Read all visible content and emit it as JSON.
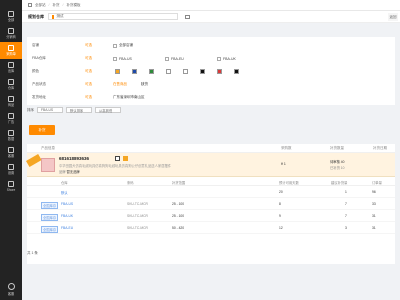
{
  "nav": {
    "items": [
      {
        "label": "全部"
      },
      {
        "label": "分销商"
      },
      {
        "label": "采购单",
        "active": true
      },
      {
        "label": "出库"
      },
      {
        "label": "仓库"
      },
      {
        "label": "商品"
      },
      {
        "label": "广告"
      },
      {
        "label": "数据"
      },
      {
        "label": "客服"
      },
      {
        "label": "设置"
      },
      {
        "label": "Shore"
      }
    ],
    "bottom_label": "客服"
  },
  "topbar": {
    "crumbs": [
      "全部站",
      "补货",
      "补货模板"
    ]
  },
  "subhead": {
    "title": "规划仓库",
    "selected": "测试",
    "return_label": "返回"
  },
  "filter": {
    "rows": [
      {
        "label": "店铺",
        "group": "可选",
        "options": [
          "全部店铺"
        ]
      },
      {
        "label": "FBA仓库",
        "group": "可选",
        "options": [
          "FBA-US",
          "FBA-EU",
          "FBA-UK"
        ]
      },
      {
        "label": "颜色",
        "group": "可选",
        "colors": [
          "#f5a623",
          "#1e4aa8",
          "#2e8b3a",
          "#ffffff",
          "#ffffff",
          "#111111",
          "#d93a3a",
          "#111111"
        ]
      },
      {
        "label": "产品状态",
        "group": "可选",
        "options": [
          "在售商品",
          "缺货"
        ]
      },
      {
        "label": "发货地址",
        "group": "可选",
        "address": "广东省深圳市南山区"
      }
    ],
    "sort_label": "排序",
    "dropdowns": [
      "FBA-US",
      "默认排序",
      "从高到低"
    ]
  },
  "result_button": "补货",
  "table": {
    "headers": [
      "产品信息",
      "采购数",
      "补货数量",
      "补货日期"
    ],
    "product": {
      "id": "681618893636",
      "title": "中华田园犬仿真毛绒玩具仿真狗狗毛绒玩具仿真狗公仔创意礼品送人家居摆件",
      "meta_label": "品牌",
      "meta_value": "暂无品牌",
      "qty": "¥ 1",
      "status": "待审核 40",
      "status2": "已补货 10"
    },
    "sub_headers": [
      "仓库",
      "条码",
      "补货范围",
      "预计可用天数",
      "建议补货量",
      "订单量"
    ],
    "sub_rows": [
      {
        "tag": "仓库",
        "name": "默认",
        "sku": "",
        "range": "",
        "qty1": "20",
        "qty2": "1",
        "qty3": "96"
      },
      {
        "tag": "全国库存",
        "name": "FBA-US",
        "sku": "SKU-TC-MCR",
        "range": "25 - 100",
        "qty1": "8",
        "qty2": "7",
        "qty3": "33"
      },
      {
        "tag": "全国库存",
        "name": "FBA-UK",
        "sku": "SKU-TC-MCR",
        "range": "25 - 100",
        "qty1": "9",
        "qty2": "7",
        "qty3": "31"
      },
      {
        "tag": "全国库存",
        "name": "FBA-EU",
        "sku": "SKU-TC-MCR",
        "range": "50 - 420",
        "qty1": "12",
        "qty2": "3",
        "qty3": "31"
      }
    ]
  },
  "footer": "共 1 条"
}
